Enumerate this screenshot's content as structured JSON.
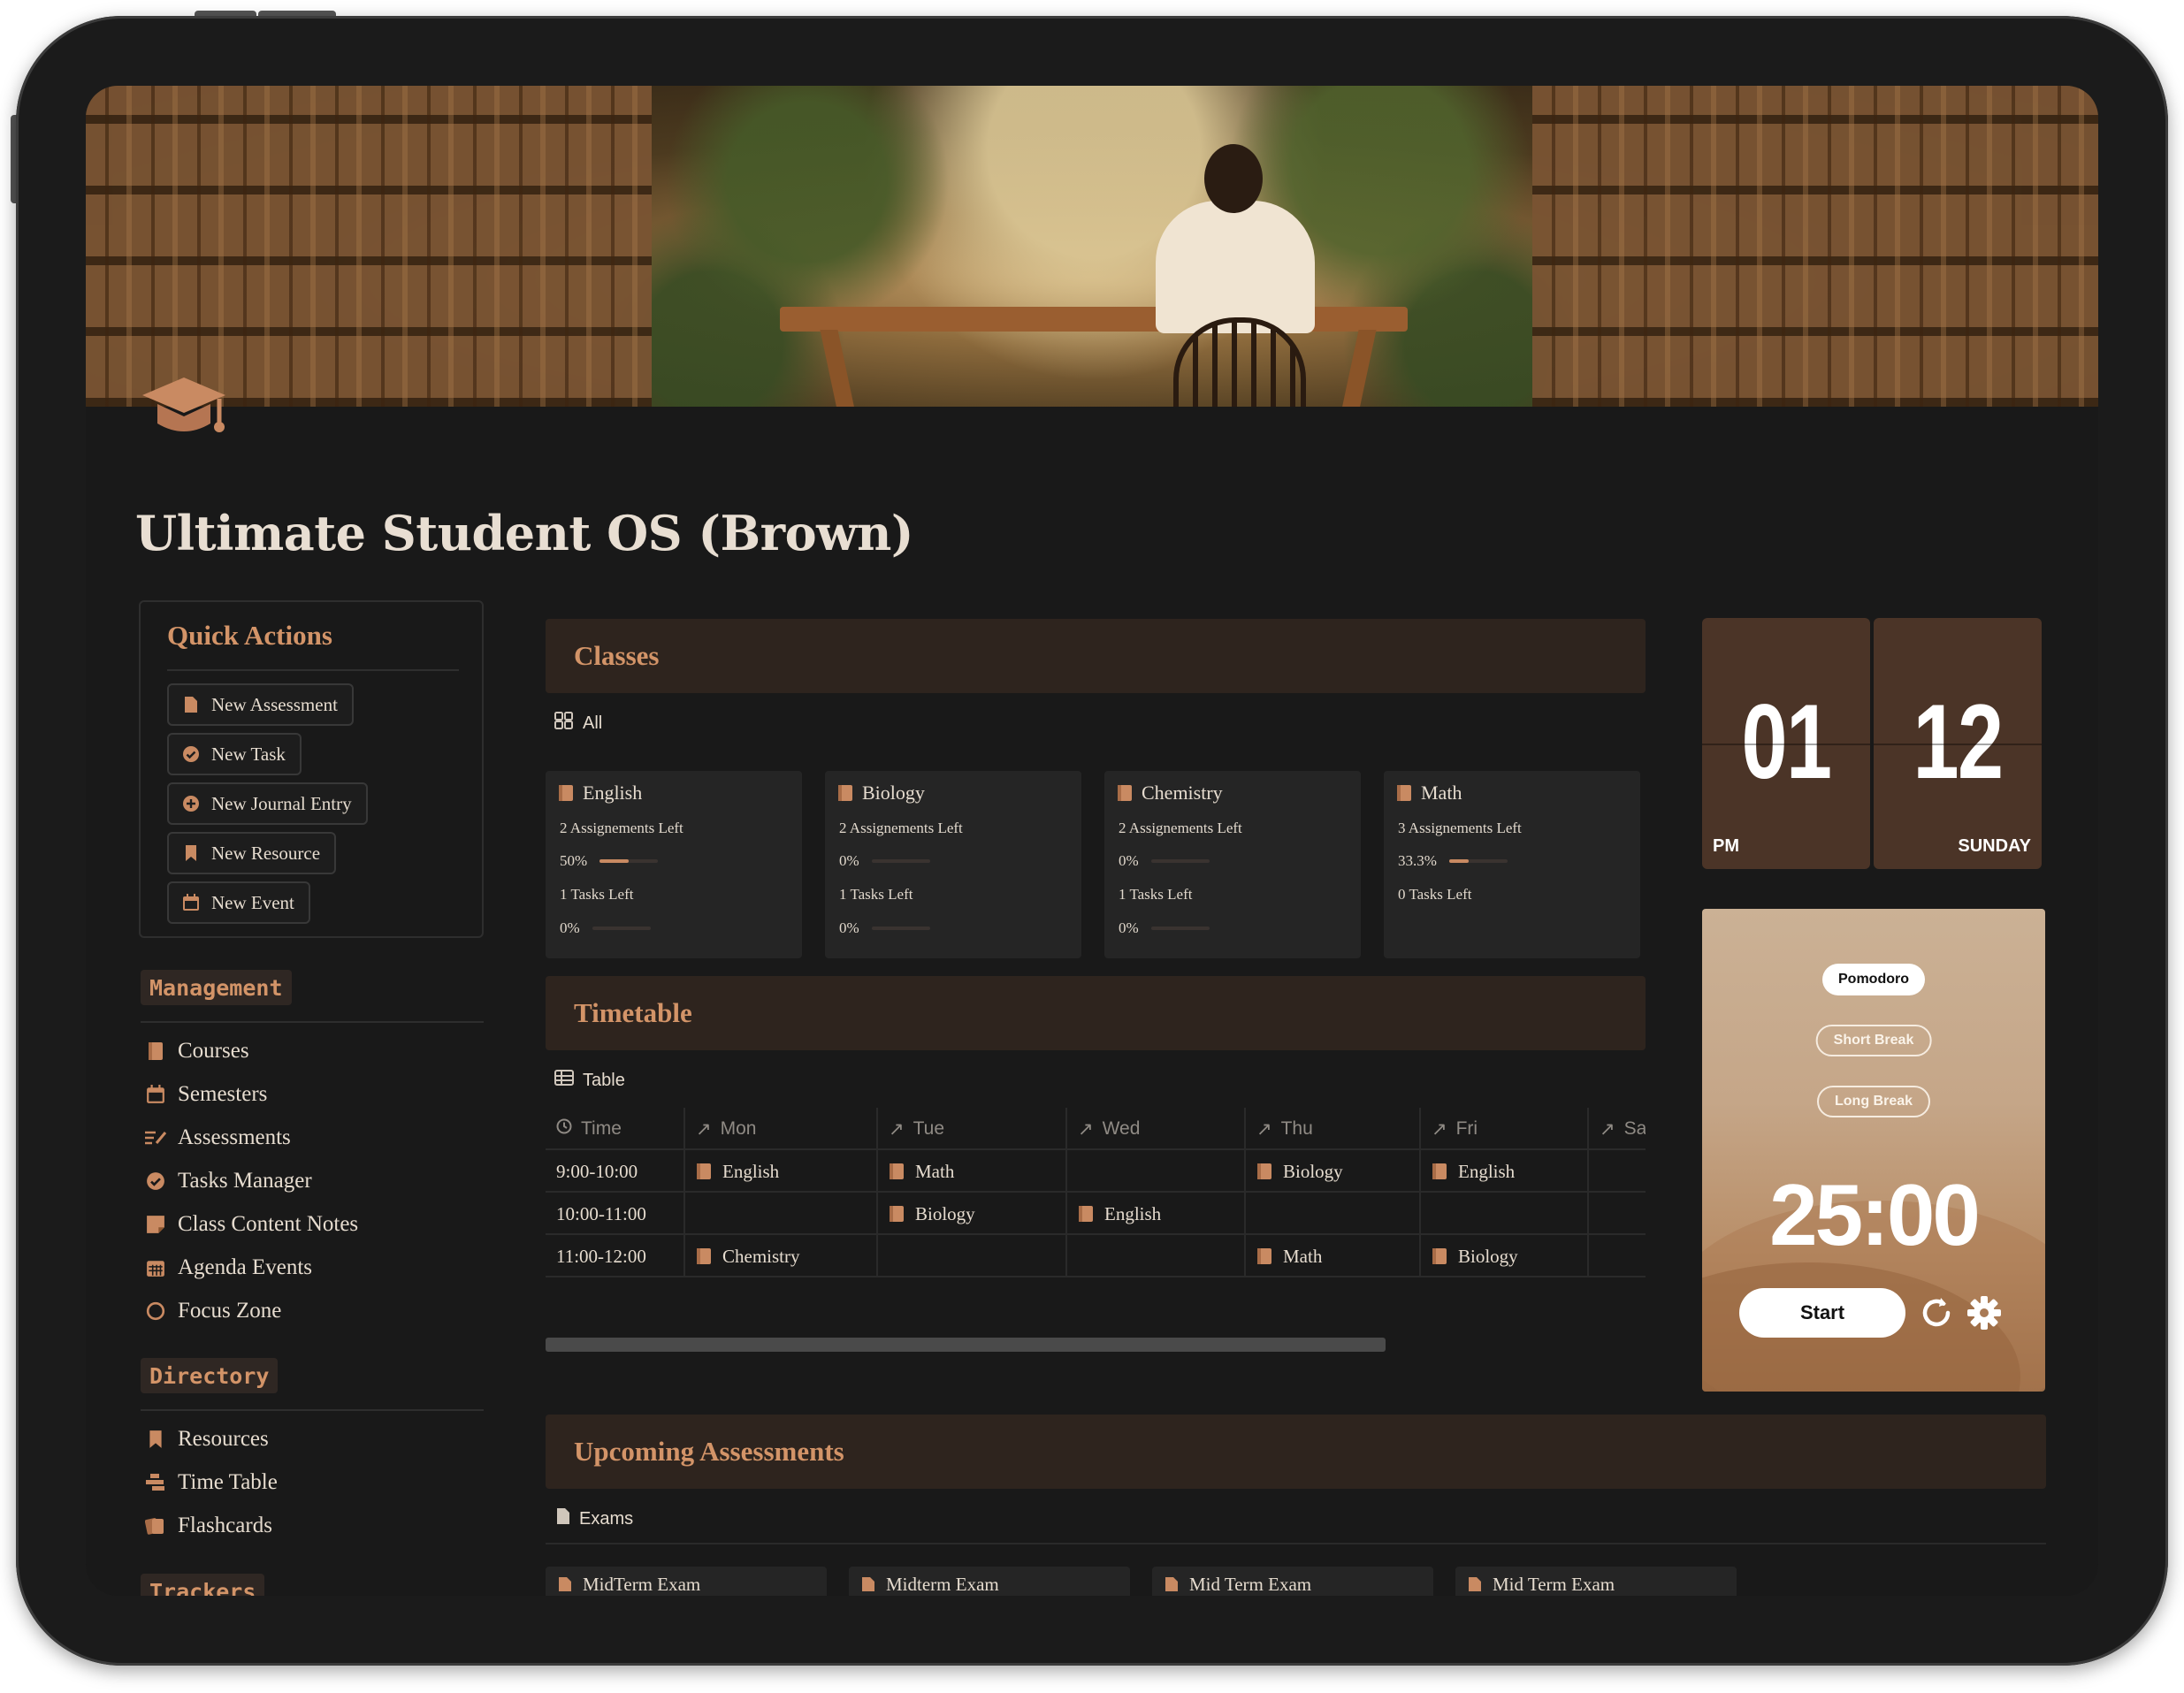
{
  "page": {
    "title": "Ultimate Student OS (Brown)"
  },
  "quick_actions": {
    "title": "Quick Actions",
    "buttons": [
      {
        "label": "New Assessment",
        "icon": "document-icon"
      },
      {
        "label": "New Task",
        "icon": "check-circle-icon"
      },
      {
        "label": "New Journal Entry",
        "icon": "plus-circle-icon"
      },
      {
        "label": "New Resource",
        "icon": "bookmark-icon"
      },
      {
        "label": "New Event",
        "icon": "calendar-icon"
      }
    ]
  },
  "management": {
    "label": "Management",
    "items": [
      {
        "label": "Courses",
        "icon": "book-icon"
      },
      {
        "label": "Semesters",
        "icon": "calendar-icon"
      },
      {
        "label": "Assessments",
        "icon": "checklist-icon"
      },
      {
        "label": "Tasks Manager",
        "icon": "check-circle-icon"
      },
      {
        "label": "Class Content Notes",
        "icon": "note-icon"
      },
      {
        "label": "Agenda Events",
        "icon": "calendar-grid-icon"
      },
      {
        "label": "Focus Zone",
        "icon": "circle-icon"
      }
    ]
  },
  "directory": {
    "label": "Directory",
    "items": [
      {
        "label": "Resources",
        "icon": "bookmark-icon"
      },
      {
        "label": "Time Table",
        "icon": "timeline-icon"
      },
      {
        "label": "Flashcards",
        "icon": "cards-icon"
      }
    ]
  },
  "trackers": {
    "label": "Trackers"
  },
  "classes": {
    "title": "Classes",
    "view_label": "All",
    "cards": [
      {
        "name": "English",
        "assignments": "2 Assignements Left",
        "assign_pct": "50%",
        "assign_fraction": 0.5,
        "tasks": "1 Tasks Left",
        "task_pct": "0%",
        "task_fraction": 0
      },
      {
        "name": "Biology",
        "assignments": "2 Assignements Left",
        "assign_pct": "0%",
        "assign_fraction": 0,
        "tasks": "1 Tasks Left",
        "task_pct": "0%",
        "task_fraction": 0
      },
      {
        "name": "Chemistry",
        "assignments": "2 Assignements Left",
        "assign_pct": "0%",
        "assign_fraction": 0,
        "tasks": "1 Tasks Left",
        "task_pct": "0%",
        "task_fraction": 0
      },
      {
        "name": "Math",
        "assignments": "3 Assignements Left",
        "assign_pct": "33.3%",
        "assign_fraction": 0.333,
        "tasks": "0 Tasks Left"
      }
    ]
  },
  "timetable": {
    "title": "Timetable",
    "view_label": "Table",
    "columns": [
      "Time",
      "Mon",
      "Tue",
      "Wed",
      "Thu",
      "Fri",
      "Sa"
    ],
    "rows": [
      [
        "9:00-10:00",
        "English",
        "Math",
        "",
        "Biology",
        "English",
        ""
      ],
      [
        "10:00-11:00",
        "",
        "Biology",
        "English",
        "",
        "",
        ""
      ],
      [
        "11:00-12:00",
        "Chemistry",
        "",
        "",
        "Math",
        "Biology",
        ""
      ]
    ]
  },
  "clock": {
    "hour": "01",
    "minute": "12",
    "ampm": "PM",
    "day": "SUNDAY"
  },
  "pomodoro": {
    "modes": [
      "Pomodoro",
      "Short Break",
      "Long Break"
    ],
    "active_mode": "Pomodoro",
    "time": "25:00",
    "start_label": "Start"
  },
  "upcoming": {
    "title": "Upcoming Assessments",
    "view_label": "Exams",
    "cards": [
      "MidTerm Exam",
      "Midterm Exam",
      "Mid Term Exam",
      "Mid Term Exam"
    ]
  },
  "colors": {
    "accent": "#d39468",
    "icon_brown": "#c98a62",
    "background": "#191919",
    "header_bar": "#2e241e",
    "card": "#252525"
  }
}
